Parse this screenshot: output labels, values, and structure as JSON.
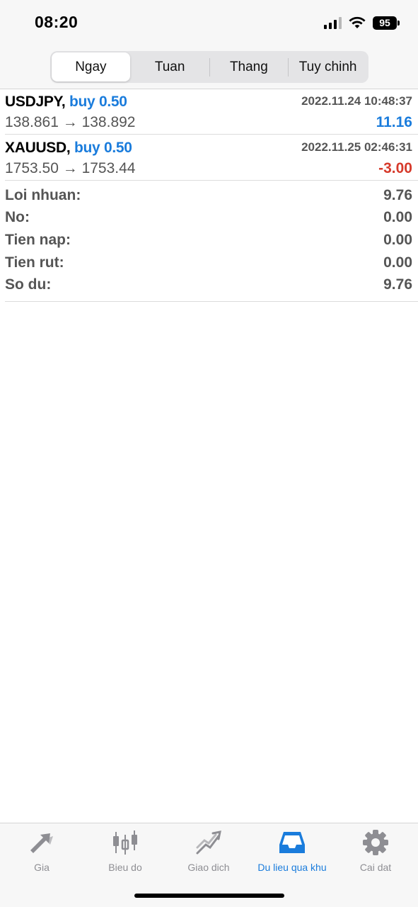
{
  "status_bar": {
    "time": "08:20",
    "battery": "95"
  },
  "segments": [
    {
      "label": "Ngay",
      "active": true
    },
    {
      "label": "Tuan",
      "active": false
    },
    {
      "label": "Thang",
      "active": false
    },
    {
      "label": "Tuy chinh",
      "active": false
    }
  ],
  "trades": [
    {
      "symbol": "USDJPY,",
      "action": "buy 0.50",
      "time": "2022.11.24 10:48:37",
      "prices": "138.861 → 138.892",
      "profit": "11.16",
      "profit_color": "#1a7cdc"
    },
    {
      "symbol": "XAUUSD,",
      "action": "buy 0.50",
      "time": "2022.11.25 02:46:31",
      "prices": "1753.50 → 1753.44",
      "profit": "-3.00",
      "profit_color": "#d63a2b"
    }
  ],
  "summary": [
    {
      "label": "Loi nhuan:",
      "value": "9.76"
    },
    {
      "label": "No:",
      "value": "0.00"
    },
    {
      "label": "Tien nap:",
      "value": "0.00"
    },
    {
      "label": "Tien rut:",
      "value": "0.00"
    },
    {
      "label": "So du:",
      "value": "9.76"
    }
  ],
  "tabbar": [
    {
      "label": "Gia",
      "icon": "price-arrows-icon",
      "active": false
    },
    {
      "label": "Bieu do",
      "icon": "candlestick-chart-icon",
      "active": false
    },
    {
      "label": "Giao dich",
      "icon": "trade-trend-icon",
      "active": false
    },
    {
      "label": "Du lieu qua khu",
      "icon": "history-inbox-icon",
      "active": true
    },
    {
      "label": "Cai dat",
      "icon": "gear-icon",
      "active": false
    }
  ],
  "colors": {
    "accent": "#1a7cdc",
    "loss": "#d63a2b",
    "muted": "#8e8e93"
  }
}
